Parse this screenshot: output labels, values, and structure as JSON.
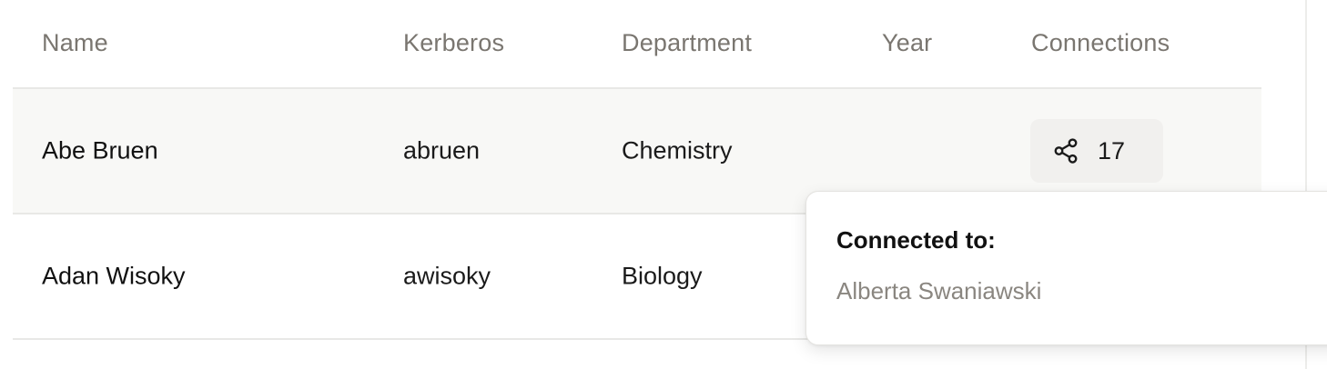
{
  "table": {
    "columns": [
      "Name",
      "Kerberos",
      "Department",
      "Year",
      "Connections"
    ],
    "rows": [
      {
        "name": "Abe Bruen",
        "kerberos": "abruen",
        "department": "Chemistry",
        "year": "",
        "connections": "17"
      },
      {
        "name": "Adan Wisoky",
        "kerberos": "awisoky",
        "department": "Biology",
        "year": "",
        "connections": ""
      }
    ]
  },
  "popover": {
    "title": "Connected to:",
    "items": [
      "Alberta Swaniawski"
    ]
  },
  "icons": {
    "connections": "share-icon"
  },
  "colors": {
    "header_text": "#7a7670",
    "hover_row_bg": "#f8f8f6",
    "button_bg": "#f1f0ee",
    "muted_text": "#8a8680"
  }
}
